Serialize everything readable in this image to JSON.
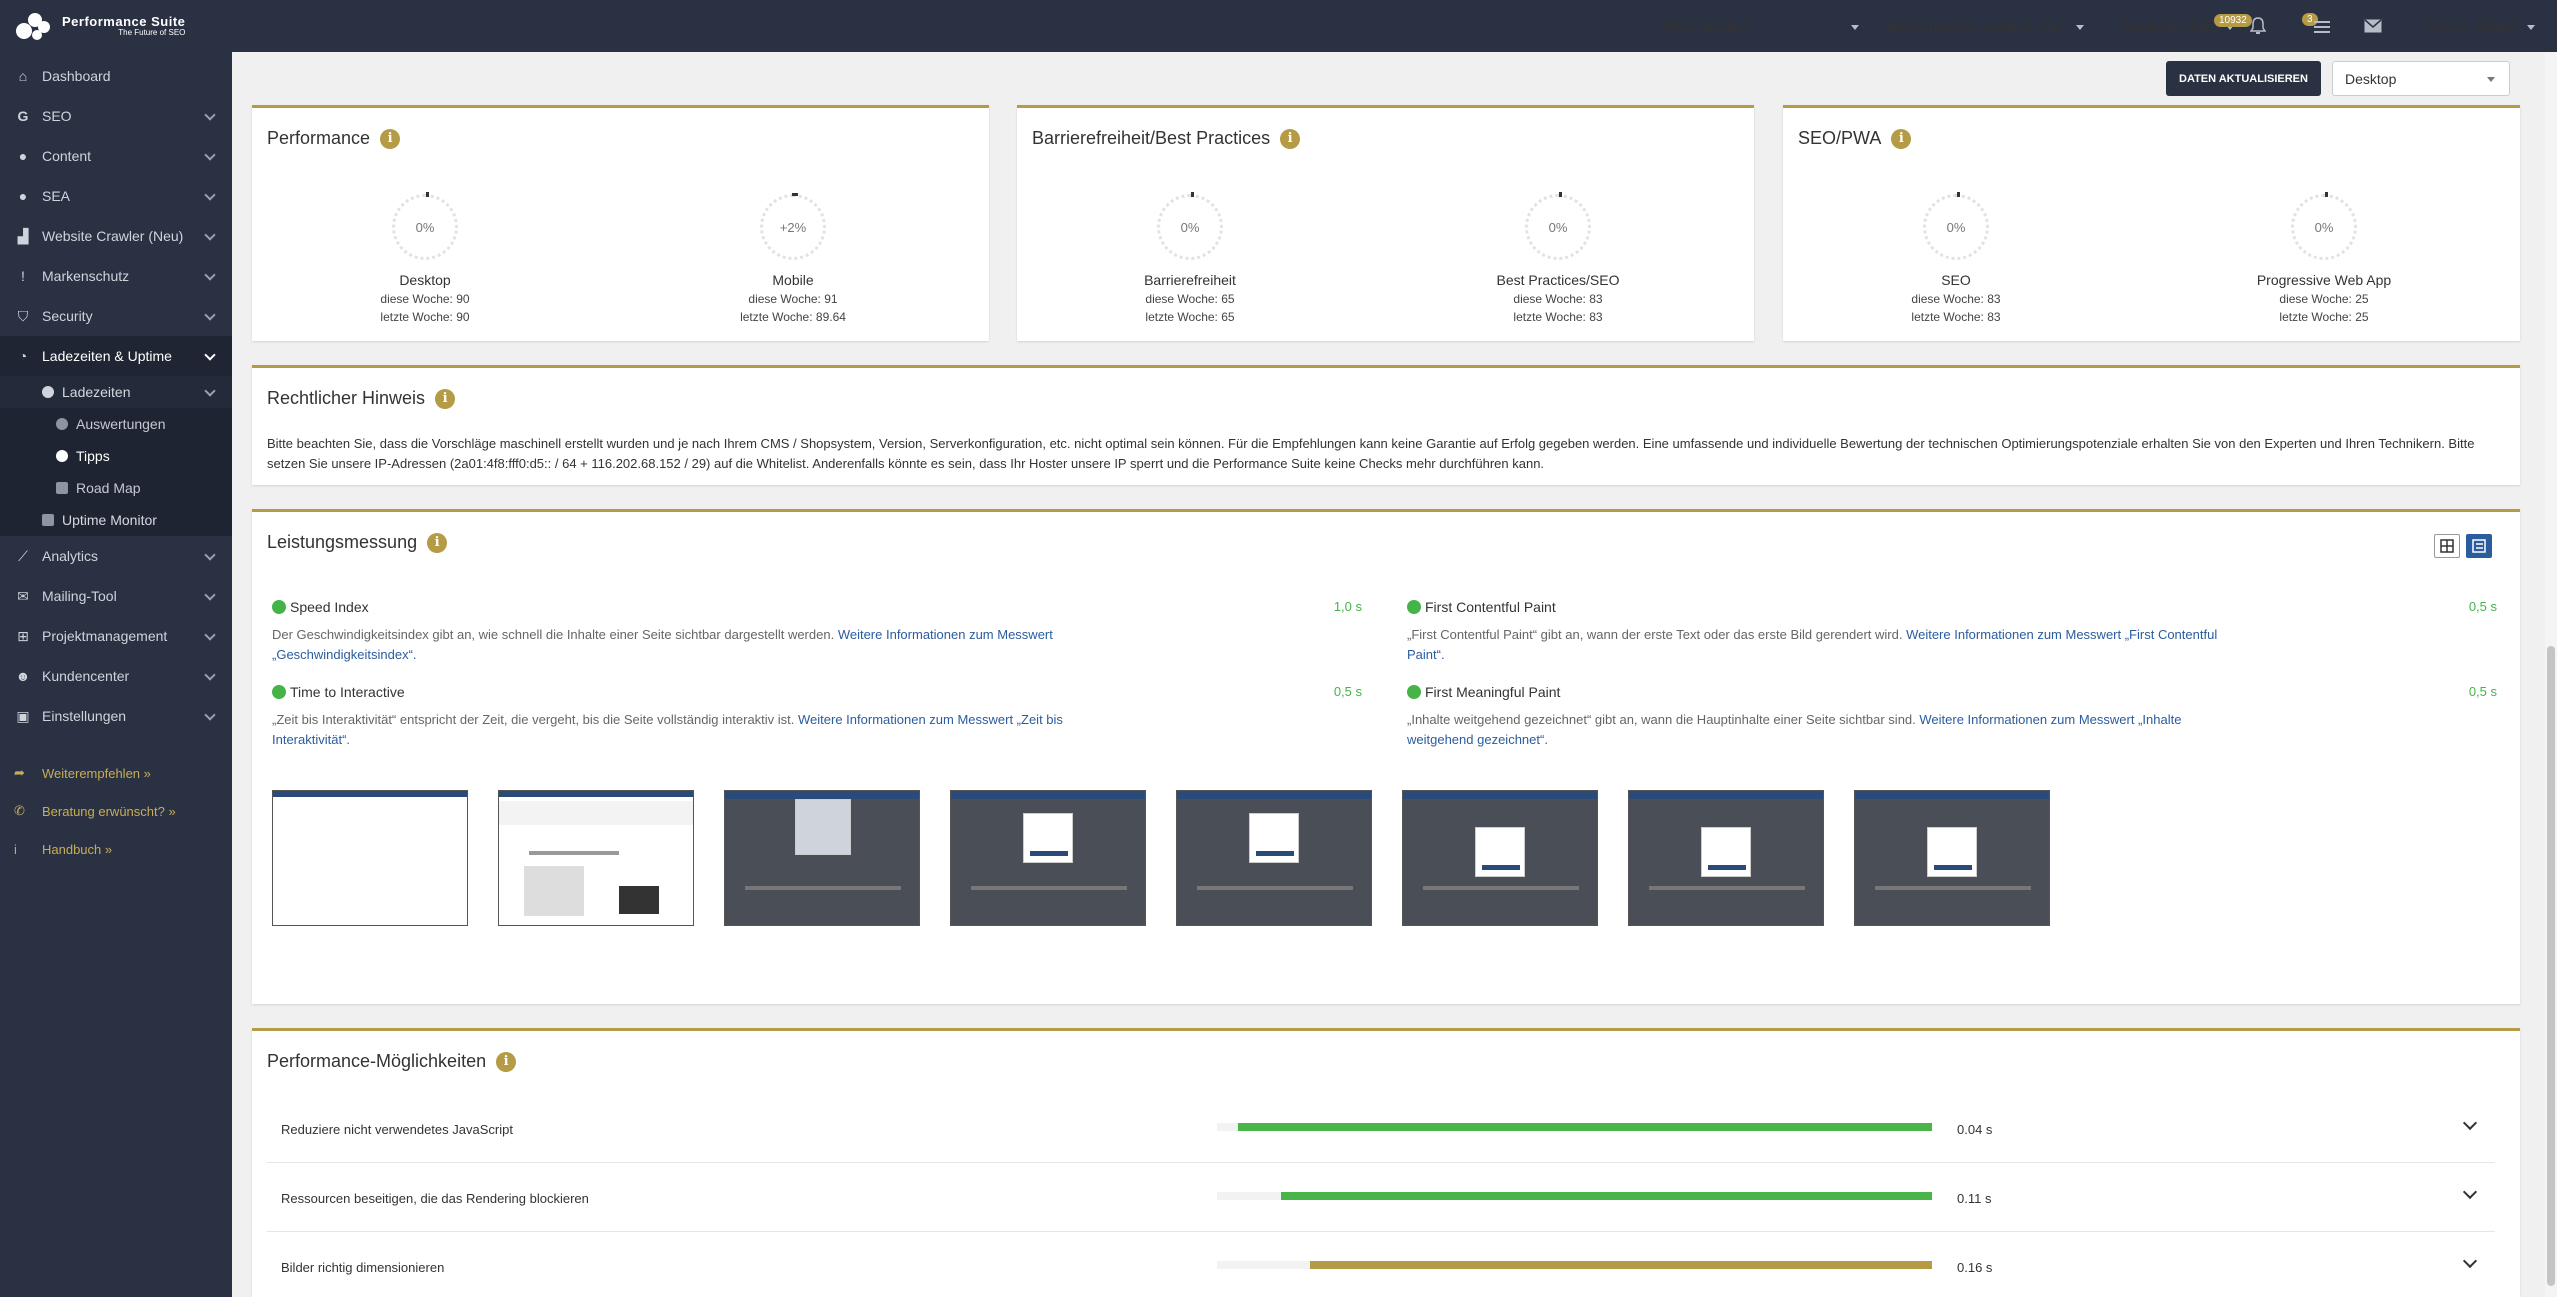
{
  "brand": {
    "name": "Performance Suite",
    "tagline": "The Future of SEO"
  },
  "topbar": {
    "customer_select": "Alle Kunden",
    "domain_select": "performance-suite.io (de)",
    "language": "Sprache (DE)",
    "notification_count": "10932",
    "message_count": "3",
    "user": "Florian Müller"
  },
  "sidebar": {
    "items": [
      {
        "label": "Dashboard",
        "icon": "home-icon"
      },
      {
        "label": "SEO",
        "icon": "google-g-icon"
      },
      {
        "label": "Content",
        "icon": "globe-icon"
      },
      {
        "label": "SEA",
        "icon": "globe-icon"
      },
      {
        "label": "Website Crawler (Neu)",
        "icon": "chart-icon"
      },
      {
        "label": "Markenschutz",
        "icon": "exclamation-icon"
      },
      {
        "label": "Security",
        "icon": "shield-icon"
      },
      {
        "label": "Ladezeiten & Uptime",
        "icon": "clock-icon"
      }
    ],
    "sub": {
      "ladezeiten": "Ladezeiten",
      "auswertungen": "Auswertungen",
      "tipps": "Tipps",
      "roadmap": "Road Map",
      "uptime": "Uptime Monitor"
    },
    "items2": [
      {
        "label": "Analytics",
        "icon": "line-chart-icon"
      },
      {
        "label": "Mailing-Tool",
        "icon": "mail-icon"
      },
      {
        "label": "Projektmanagement",
        "icon": "sitemap-icon"
      },
      {
        "label": "Kundencenter",
        "icon": "users-icon"
      },
      {
        "label": "Einstellungen",
        "icon": "lock-icon"
      }
    ],
    "links": [
      {
        "label": "Weiterempfehlen »",
        "icon": "share-icon"
      },
      {
        "label": "Beratung erwünscht? »",
        "icon": "chat-icon"
      },
      {
        "label": "Handbuch »",
        "icon": "info-icon"
      }
    ]
  },
  "toolbar": {
    "refresh_label": "DATEN AKTUALISIEREN",
    "device_select": "Desktop"
  },
  "scores": [
    {
      "title": "Performance",
      "gauges": [
        {
          "value": "0%",
          "name": "Desktop",
          "this_week": "diese Woche: 90",
          "last_week": "letzte Woche: 90"
        },
        {
          "value": "+2%",
          "name": "Mobile",
          "this_week": "diese Woche: 91",
          "last_week": "letzte Woche: 89.64"
        }
      ]
    },
    {
      "title": "Barrierefreiheit/Best Practices",
      "gauges": [
        {
          "value": "0%",
          "name": "Barrierefreiheit",
          "this_week": "diese Woche: 65",
          "last_week": "letzte Woche: 65"
        },
        {
          "value": "0%",
          "name": "Best Practices/SEO",
          "this_week": "diese Woche: 83",
          "last_week": "letzte Woche: 83"
        }
      ]
    },
    {
      "title": "SEO/PWA",
      "gauges": [
        {
          "value": "0%",
          "name": "SEO",
          "this_week": "diese Woche: 83",
          "last_week": "letzte Woche: 83"
        },
        {
          "value": "0%",
          "name": "Progressive Web App",
          "this_week": "diese Woche: 25",
          "last_week": "letzte Woche: 25"
        }
      ]
    }
  ],
  "legal": {
    "title": "Rechtlicher Hinweis",
    "text": "Bitte beachten Sie, dass die Vorschläge maschinell erstellt wurden und je nach Ihrem CMS / Shopsystem, Version, Serverkonfiguration, etc. nicht optimal sein können. Für die Empfehlungen kann keine Garantie auf Erfolg gegeben werden. Eine umfassende und individuelle Bewertung der technischen Optimierungspotenziale erhalten Sie von den Experten und Ihren Technikern. Bitte setzen Sie unsere IP-Adressen (2a01:4f8:fff0:d5:: / 64 + 116.202.68.152 / 29) auf die Whitelist. Anderenfalls könnte es sein, dass Ihr Hoster unsere IP sperrt und die Performance Suite keine Checks mehr durchführen kann."
  },
  "measurement": {
    "title": "Leistungsmessung",
    "metrics": [
      {
        "name": "Speed Index",
        "value": "1,0 s",
        "desc": "Der Geschwindigkeitsindex gibt an, wie schnell die Inhalte einer Seite sichtbar dargestellt werden. ",
        "link": "Weitere Informationen zum Messwert „Geschwindigkeitsindex“."
      },
      {
        "name": "First Contentful Paint",
        "value": "0,5 s",
        "desc": "„First Contentful Paint“ gibt an, wann der erste Text oder das erste Bild gerendert wird. ",
        "link": "Weitere Informationen zum Messwert „First Contentful Paint“."
      },
      {
        "name": "Time to Interactive",
        "value": "0,5 s",
        "desc": "„Zeit bis Interaktivität“ entspricht der Zeit, die vergeht, bis die Seite vollständig interaktiv ist. ",
        "link": "Weitere Informationen zum Messwert „Zeit bis Interaktivität“."
      },
      {
        "name": "First Meaningful Paint",
        "value": "0,5 s",
        "desc": "„Inhalte weitgehend gezeichnet“ gibt an, wann die Hauptinhalte einer Seite sichtbar sind. ",
        "link": "Weitere Informationen zum Messwert „Inhalte weitgehend gezeichnet“."
      }
    ]
  },
  "opportunities": {
    "title": "Performance-Möglichkeiten",
    "rows": [
      {
        "label": "Reduziere nicht verwendetes JavaScript",
        "value": "0.04 s",
        "fill": 0.97,
        "color": "#48b44a"
      },
      {
        "label": "Ressourcen beseitigen, die das Rendering blockieren",
        "value": "0.11 s",
        "fill": 0.91,
        "color": "#48b44a"
      },
      {
        "label": "Bilder richtig dimensionieren",
        "value": "0.16 s",
        "fill": 0.87,
        "color": "#b59b45"
      }
    ]
  }
}
